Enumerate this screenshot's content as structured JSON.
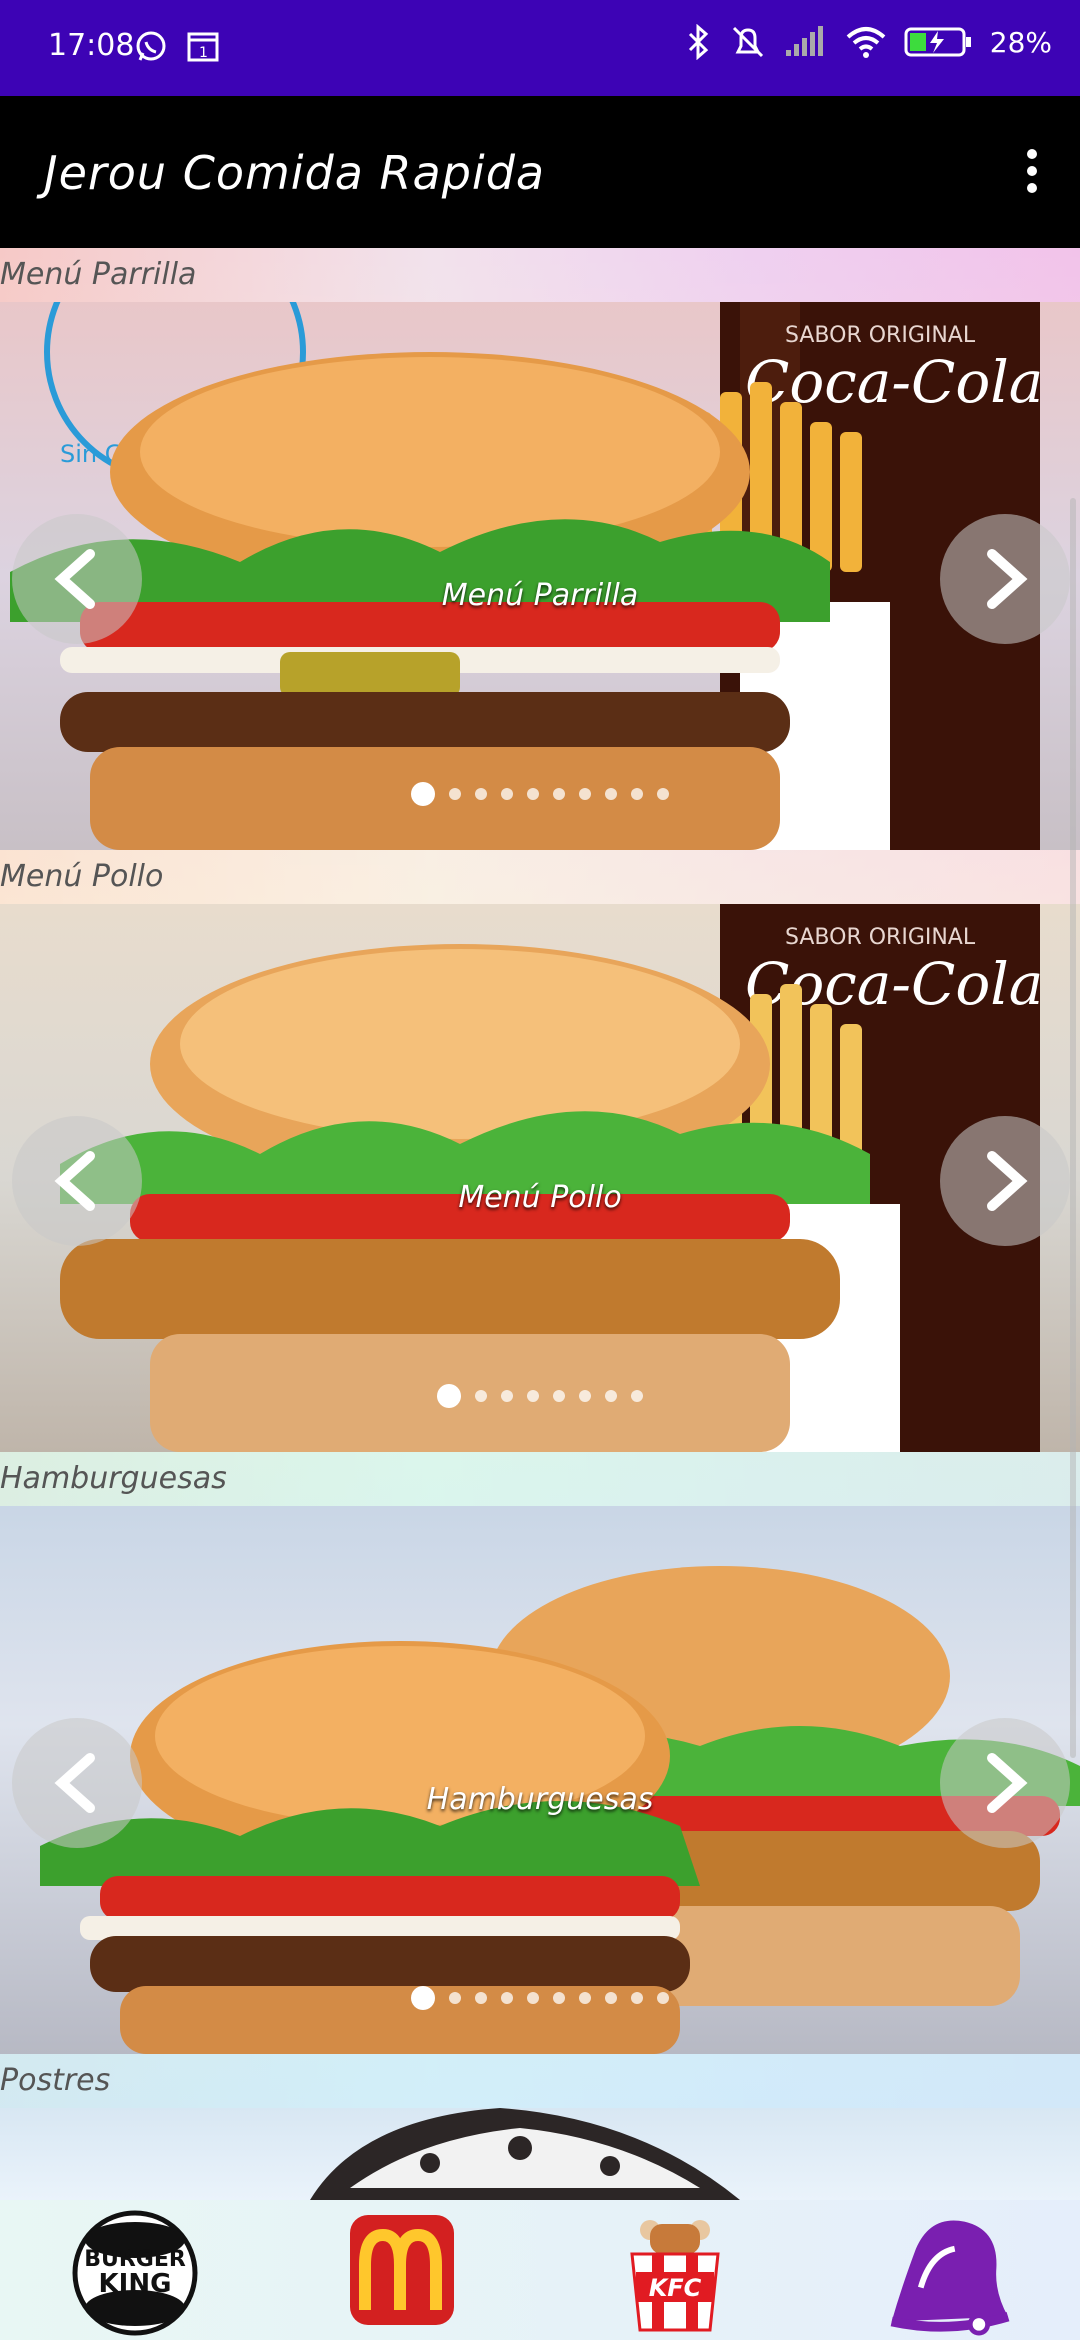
{
  "status_bar": {
    "time": "17:08",
    "battery_percent": "28%",
    "icons": [
      "whatsapp-icon",
      "calendar-icon",
      "bluetooth-icon",
      "mute-icon",
      "signal-icon",
      "wifi-icon",
      "battery-icon"
    ]
  },
  "app_bar": {
    "title": "Jerou Comida Rapida",
    "menu_icon": "more-vert-icon"
  },
  "sections": [
    {
      "label": "Menú Parrilla",
      "caption": "Menú Parrilla",
      "slide_count": 10,
      "active_index": 0
    },
    {
      "label": "Menú Pollo",
      "caption": "Menú Pollo",
      "slide_count": 8,
      "active_index": 0
    },
    {
      "label": "Hamburguesas",
      "caption": "Hamburguesas",
      "slide_count": 10,
      "active_index": 0
    },
    {
      "label": "Postres"
    }
  ],
  "image_text": {
    "sabor_original": "SABOR ORIGINAL",
    "coca_cola": "Coca-Cola",
    "gluten_free": "Sin Gluten / Gluten-Free"
  },
  "bottom_nav": {
    "brands": [
      "burger-king-logo",
      "mcdonalds-logo",
      "kfc-logo",
      "taco-bell-logo"
    ],
    "colors": {
      "mcdonalds": "#d32020",
      "mcdonalds_arch": "#ffc72c",
      "tacobell": "#7a1fb0",
      "kfc": "#e11b22"
    }
  },
  "colors": {
    "status_bar": "#3d03b5",
    "app_bar": "#000000"
  }
}
